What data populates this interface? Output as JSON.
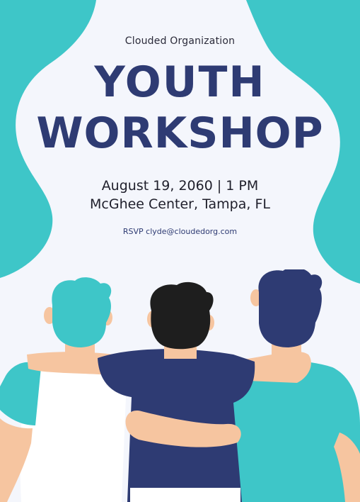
{
  "poster": {
    "organization": "Clouded Organization",
    "title_line_1": "YOUTH",
    "title_line_2": "WORKSHOP",
    "date_time": "August 19, 2060 | 1 PM",
    "venue": "McGhee Center, Tampa, FL",
    "rsvp": "RSVP clyde@cloudedorg.com"
  },
  "colors": {
    "teal": "#3ec6c8",
    "navy": "#2e3b73",
    "background": "#f4f6fc",
    "skin": "#f6c5a0",
    "dark_hair": "#1e1e1e"
  },
  "icons": {
    "illustration": "three-friends-hugging-illustration"
  }
}
